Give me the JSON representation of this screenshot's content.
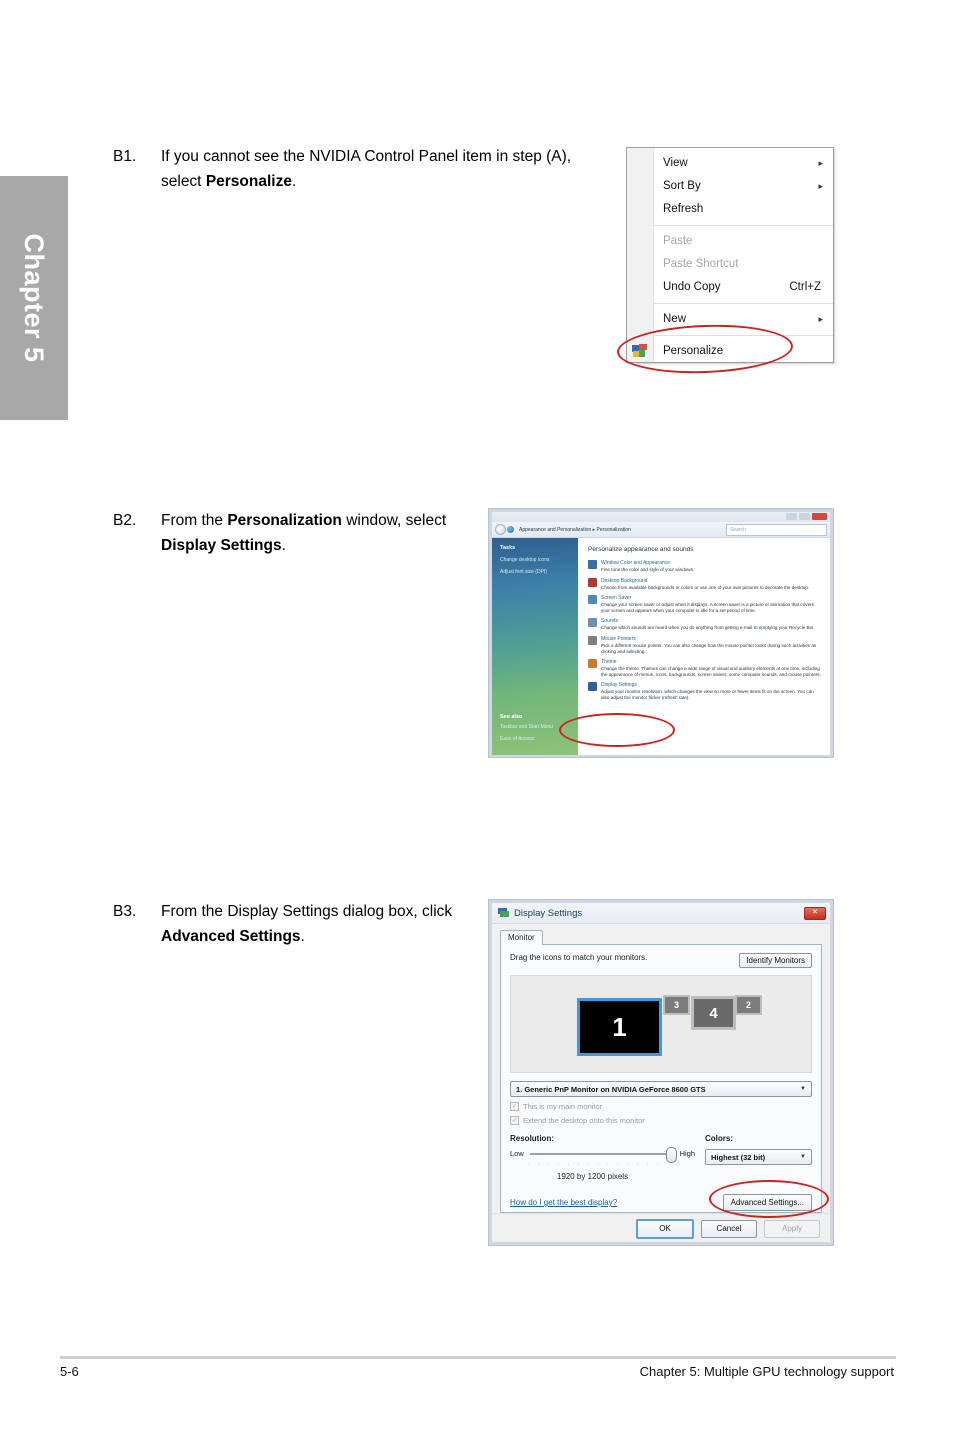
{
  "page": {
    "chapter_tab": "Chapter 5",
    "footer_page_number": "5-6",
    "footer_chapter": "Chapter 5: Multiple GPU technology support"
  },
  "steps": [
    {
      "number": "B1.",
      "text_before": "If you cannot see the NVIDIA Control Panel item in step (A), select ",
      "bold": "Personalize",
      "text_after": "."
    },
    {
      "number": "B2.",
      "text_before": "From the ",
      "bold": "Personalization",
      "text_mid": " window, select ",
      "bold2": "Display Settings",
      "text_after": "."
    },
    {
      "number": "B3.",
      "text_before": "From the Display Settings dialog box, click ",
      "bold": "Advanced Settings",
      "text_after": "."
    }
  ],
  "context_menu": {
    "items": [
      {
        "label": "View",
        "submenu": "▸",
        "accel": "",
        "disabled": false
      },
      {
        "label": "Sort By",
        "submenu": "▸",
        "accel": "",
        "disabled": false
      },
      {
        "label": "Refresh",
        "submenu": "",
        "accel": "",
        "disabled": false
      },
      {
        "label": "Paste",
        "submenu": "",
        "accel": "",
        "disabled": true
      },
      {
        "label": "Paste Shortcut",
        "submenu": "",
        "accel": "",
        "disabled": true
      },
      {
        "label": "Undo Copy",
        "submenu": "",
        "accel": "Ctrl+Z",
        "disabled": false
      },
      {
        "label": "New",
        "submenu": "▸",
        "accel": "",
        "disabled": false
      },
      {
        "label": "Personalize",
        "submenu": "",
        "accel": "",
        "disabled": false,
        "icon": "personalize-icon"
      }
    ],
    "highlight_color": "#cc2222"
  },
  "personalization_window": {
    "breadcrumb": "Appearance and Personalization  ▸  Personalization",
    "search_placeholder": "Search",
    "nav": {
      "heading": "Tasks",
      "links": [
        "Change desktop icons",
        "Adjust font size (DPI)"
      ],
      "see_also_heading": "See also",
      "see_also_links": [
        "Taskbar and Start Menu",
        "Ease of Access"
      ]
    },
    "content_heading": "Personalize appearance and sounds",
    "entries": [
      {
        "title": "Window Color and Appearance",
        "description": "Fine tune the color and style of your windows.",
        "icon_color": "#3a6ea5"
      },
      {
        "title": "Desktop Background",
        "description": "Choose from available backgrounds or colors or use one of your own pictures to decorate the desktop.",
        "icon_color": "#b03a2e"
      },
      {
        "title": "Screen Saver",
        "description": "Change your screen saver or adjust when it displays. A screen saver is a picture or animation that covers your screen and appears when your computer is idle for a set period of time.",
        "icon_color": "#4d8cb5"
      },
      {
        "title": "Sounds",
        "description": "Change which sounds are heard when you do anything from getting e-mail to emptying your Recycle Bin.",
        "icon_color": "#6e8fae"
      },
      {
        "title": "Mouse Pointers",
        "description": "Pick a different mouse pointer. You can also change how the mouse pointer looks during such activities as clicking and selecting.",
        "icon_color": "#7f7f7f"
      },
      {
        "title": "Theme",
        "description": "Change the theme. Themes can change a wide range of visual and auditory elements at one time, including the appearance of menus, icons, backgrounds, screen savers, some computer sounds, and mouse pointers.",
        "icon_color": "#c77b34"
      },
      {
        "title": "Display Settings",
        "description": "Adjust your monitor resolution, which changes the view so more or fewer items fit on the screen. You can also adjust the monitor flicker (refresh rate).",
        "icon_color": "#2f5f9e"
      }
    ],
    "highlighted_entry": "Display Settings"
  },
  "display_settings_dialog": {
    "title": "Display Settings",
    "close_label": "✕",
    "tab": "Monitor",
    "drag_label": "Drag the icons to match your monitors.",
    "identify_button": "Identify Monitors",
    "monitors": [
      {
        "number": "1",
        "selected": true
      },
      {
        "number": "3",
        "selected": false
      },
      {
        "number": "4",
        "selected": false
      },
      {
        "number": "2",
        "selected": false
      }
    ],
    "monitor_select_value": "1. Generic PnP Monitor on NVIDIA GeForce 8600 GTS",
    "checkboxes": [
      {
        "label": "This is my main monitor",
        "checked": true
      },
      {
        "label": "Extend the desktop onto this monitor",
        "checked": true
      }
    ],
    "resolution_label": "Resolution:",
    "resolution_low": "Low",
    "resolution_high": "High",
    "resolution_value": "1920 by 1200 pixels",
    "colors_label": "Colors:",
    "colors_value": "Highest (32 bit)",
    "help_link": "How do I get the best display?",
    "advanced_button": "Advanced Settings...",
    "buttons": [
      {
        "label": "OK",
        "state": "default"
      },
      {
        "label": "Cancel",
        "state": "normal"
      },
      {
        "label": "Apply",
        "state": "disabled"
      }
    ]
  }
}
